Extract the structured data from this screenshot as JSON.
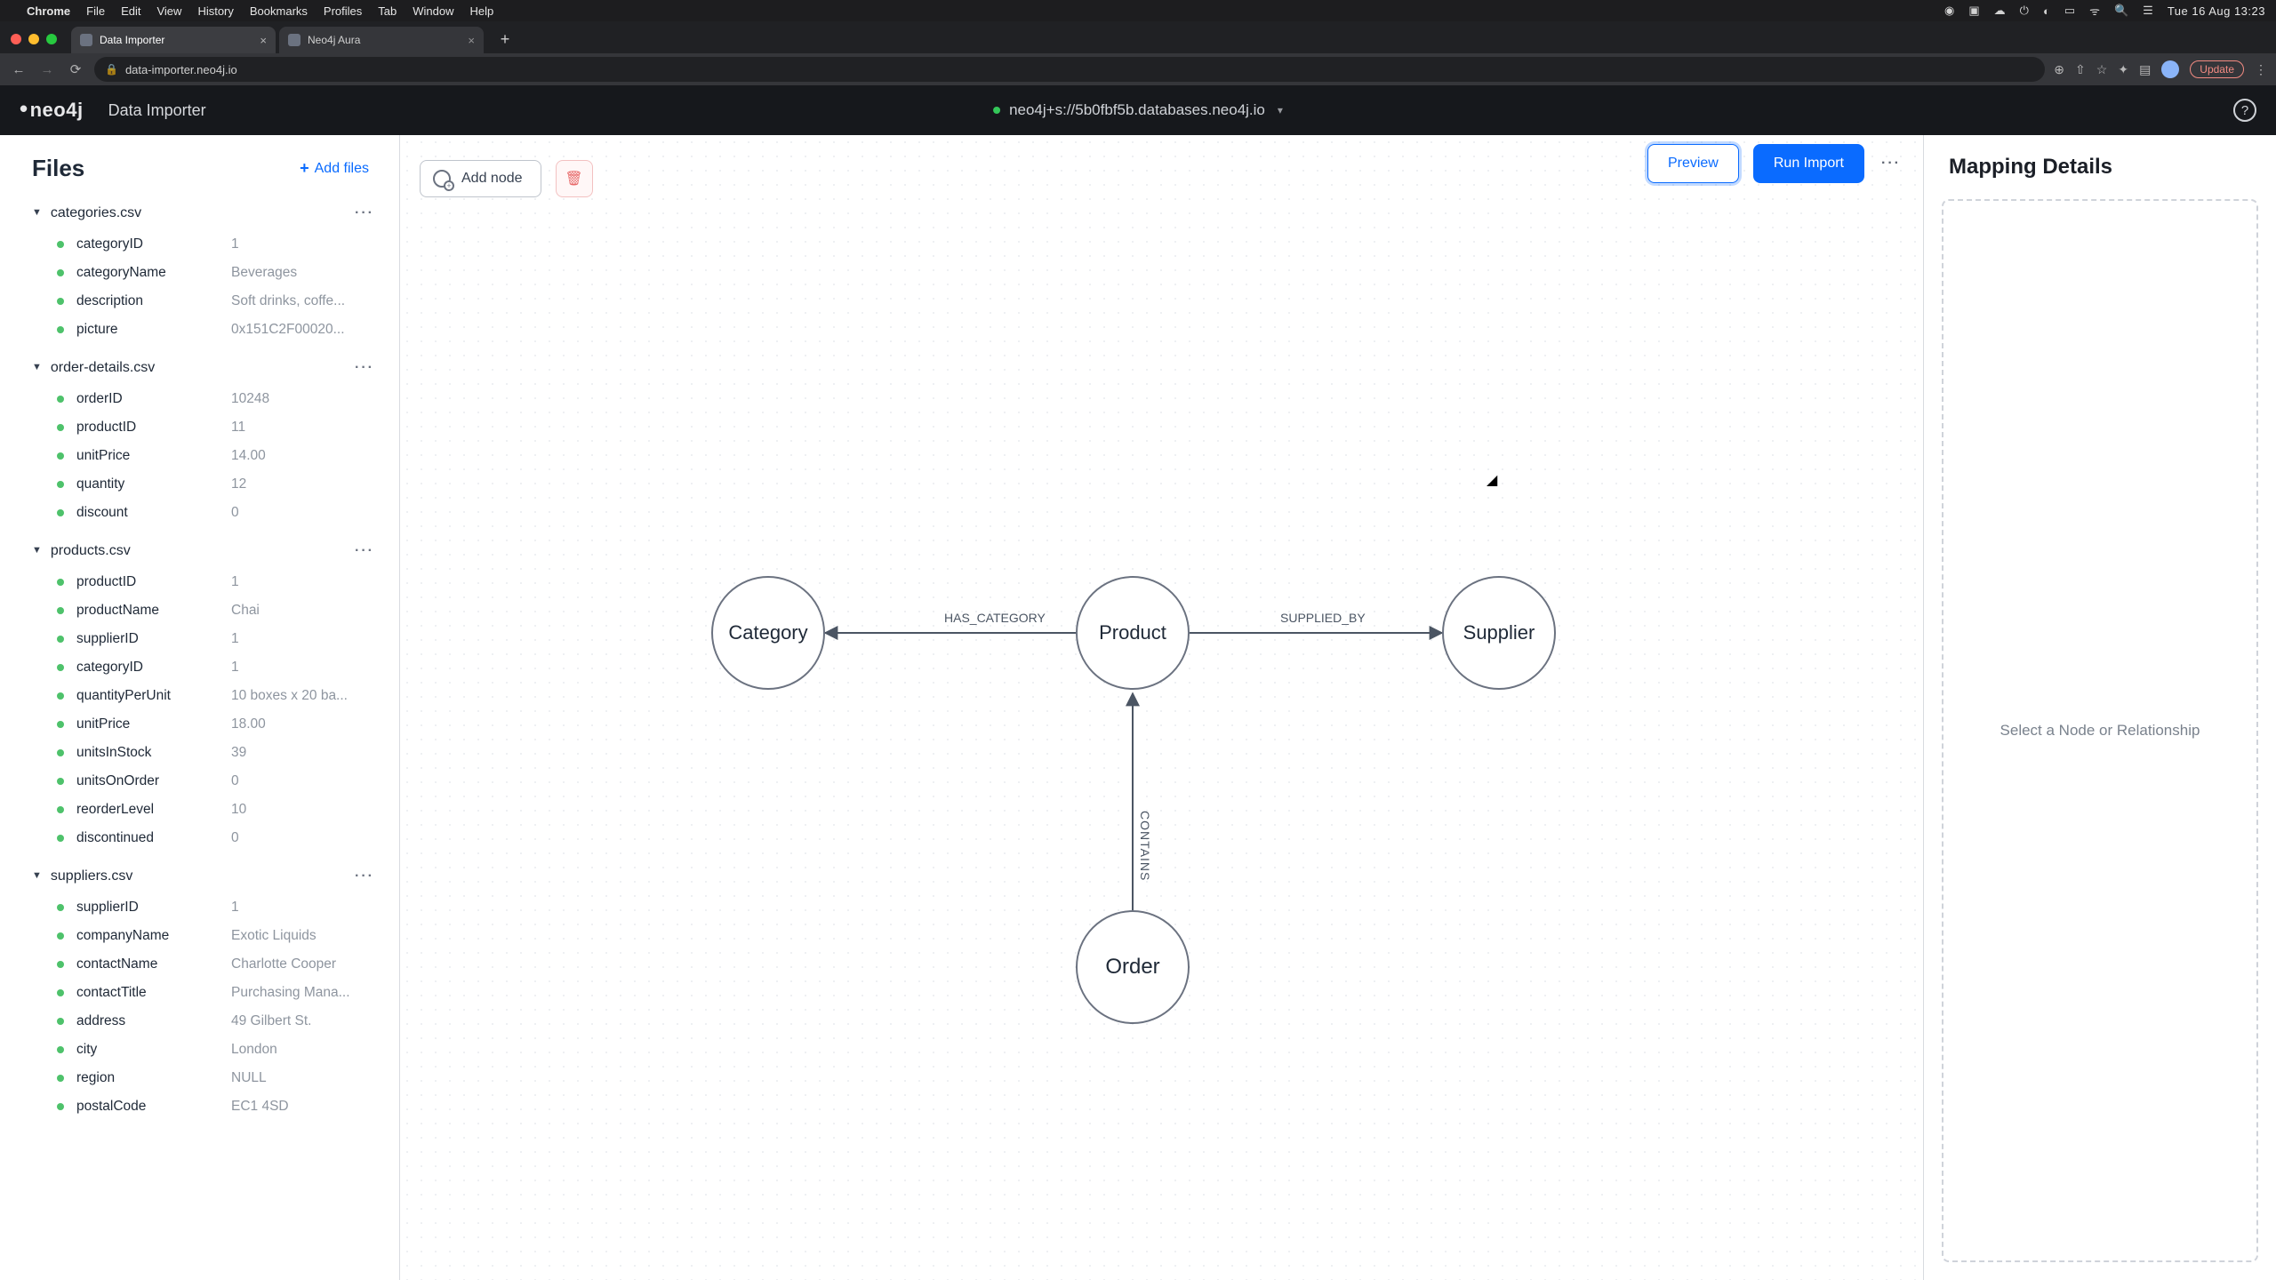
{
  "mac_menu": {
    "app": "Chrome",
    "items": [
      "File",
      "Edit",
      "View",
      "History",
      "Bookmarks",
      "Profiles",
      "Tab",
      "Window",
      "Help"
    ],
    "clock": "Tue 16 Aug  13:23"
  },
  "browser": {
    "tabs": [
      {
        "title": "Data Importer",
        "active": true
      },
      {
        "title": "Neo4j Aura",
        "active": false
      }
    ],
    "url": "data-importer.neo4j.io",
    "update_label": "Update"
  },
  "header": {
    "logo_text": "neo4j",
    "product": "Data Importer",
    "connection": "neo4j+s://5b0fbf5b.databases.neo4j.io"
  },
  "actions": {
    "preview": "Preview",
    "run_import": "Run Import",
    "add_node": "Add node",
    "add_files": "Add files"
  },
  "files": {
    "title": "Files",
    "groups": [
      {
        "name": "categories.csv",
        "fields": [
          {
            "name": "categoryID",
            "sample": "1"
          },
          {
            "name": "categoryName",
            "sample": "Beverages"
          },
          {
            "name": "description",
            "sample": "Soft drinks, coffe..."
          },
          {
            "name": "picture",
            "sample": "0x151C2F00020..."
          }
        ]
      },
      {
        "name": "order-details.csv",
        "fields": [
          {
            "name": "orderID",
            "sample": "10248"
          },
          {
            "name": "productID",
            "sample": "11"
          },
          {
            "name": "unitPrice",
            "sample": "14.00"
          },
          {
            "name": "quantity",
            "sample": "12"
          },
          {
            "name": "discount",
            "sample": "0"
          }
        ]
      },
      {
        "name": "products.csv",
        "fields": [
          {
            "name": "productID",
            "sample": "1"
          },
          {
            "name": "productName",
            "sample": "Chai"
          },
          {
            "name": "supplierID",
            "sample": "1"
          },
          {
            "name": "categoryID",
            "sample": "1"
          },
          {
            "name": "quantityPerUnit",
            "sample": "10 boxes x 20 ba..."
          },
          {
            "name": "unitPrice",
            "sample": "18.00"
          },
          {
            "name": "unitsInStock",
            "sample": "39"
          },
          {
            "name": "unitsOnOrder",
            "sample": "0"
          },
          {
            "name": "reorderLevel",
            "sample": "10"
          },
          {
            "name": "discontinued",
            "sample": "0"
          }
        ]
      },
      {
        "name": "suppliers.csv",
        "fields": [
          {
            "name": "supplierID",
            "sample": "1"
          },
          {
            "name": "companyName",
            "sample": "Exotic Liquids"
          },
          {
            "name": "contactName",
            "sample": "Charlotte Cooper"
          },
          {
            "name": "contactTitle",
            "sample": "Purchasing Mana..."
          },
          {
            "name": "address",
            "sample": "49 Gilbert St."
          },
          {
            "name": "city",
            "sample": "London"
          },
          {
            "name": "region",
            "sample": "NULL"
          },
          {
            "name": "postalCode",
            "sample": "EC1 4SD"
          }
        ]
      }
    ]
  },
  "graph": {
    "nodes": {
      "category": "Category",
      "product": "Product",
      "supplier": "Supplier",
      "order": "Order"
    },
    "rels": {
      "has_category": "HAS_CATEGORY",
      "supplied_by": "SUPPLIED_BY",
      "contains": "CONTAINS"
    }
  },
  "details": {
    "title": "Mapping Details",
    "empty": "Select a Node or Relationship"
  }
}
